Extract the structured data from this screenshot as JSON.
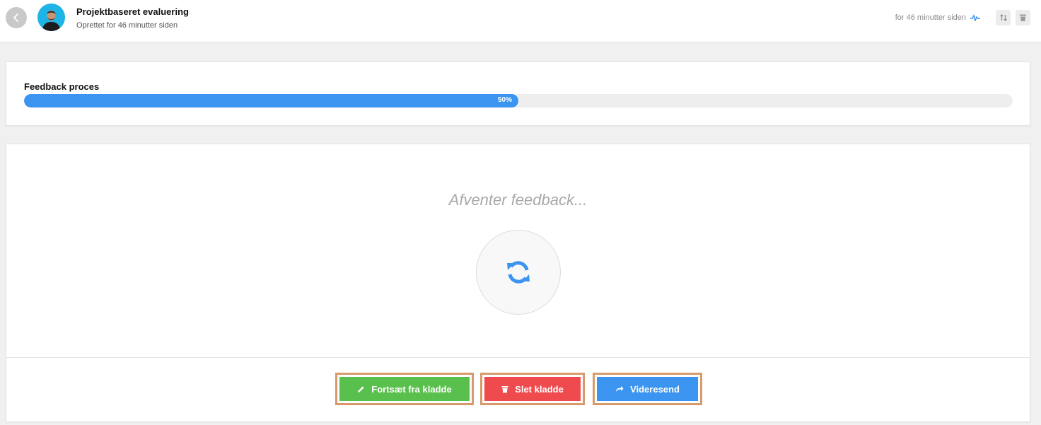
{
  "header": {
    "title": "Projektbaseret evaluering",
    "subtitle": "Oprettet for 46 minutter siden",
    "meta_time": "for 46 minutter siden",
    "icons": {
      "back": "chevron-left-icon",
      "activity": "activity-pulse-icon",
      "sort": "sort-arrows-icon",
      "delete": "trash-icon"
    }
  },
  "progress": {
    "label": "Feedback proces",
    "percent_text": "50%",
    "value": 0.5
  },
  "main": {
    "waiting_text": "Afventer feedback...",
    "spinner_icon": "refresh-icon"
  },
  "actions": {
    "continue_label": "Fortsæt fra kladde",
    "delete_label": "Slet kladde",
    "forward_label": "Videresend"
  },
  "colors": {
    "accent_blue": "#3b94f0",
    "green": "#5ac04d",
    "red": "#ef4a4d",
    "highlight_border": "#d99a6b"
  }
}
